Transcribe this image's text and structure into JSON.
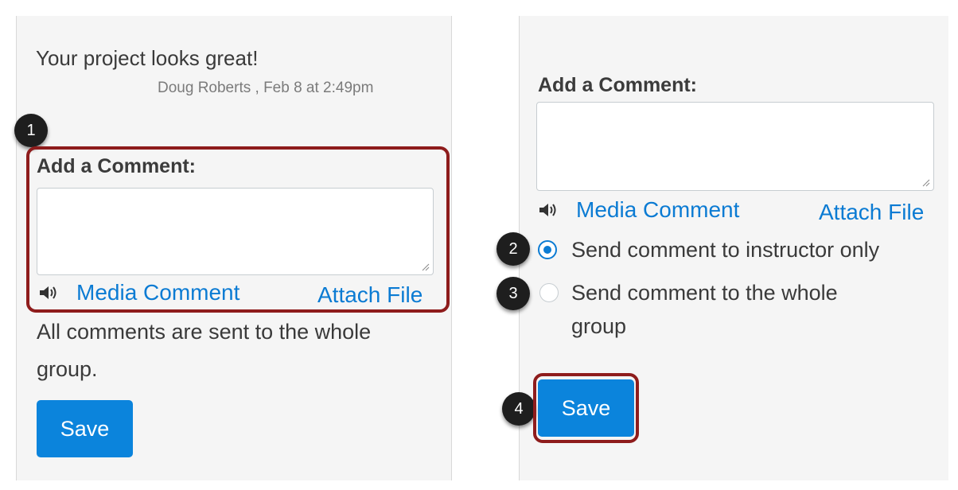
{
  "left": {
    "comment_text": "Your project looks great!",
    "comment_meta": "Doug Roberts , Feb 8 at 2:49pm",
    "badge": "1",
    "add_comment_heading": "Add a Comment:",
    "media_comment_label": "Media Comment",
    "attach_file_label": "Attach File",
    "info_line1": "All comments are sent to the whole",
    "info_line2": "group.",
    "save_label": "Save"
  },
  "right": {
    "add_comment_heading": "Add a Comment:",
    "media_comment_label": "Media Comment",
    "attach_file_label": "Attach File",
    "badge2": "2",
    "badge3": "3",
    "badge4": "4",
    "option_instructor": "Send comment to instructor only",
    "option_group_line1": "Send comment to the whole",
    "option_group_line2": "group",
    "option_instructor_checked": true,
    "save_label": "Save"
  },
  "colors": {
    "link": "#0b7bd3",
    "button": "#0b84dc",
    "highlight": "#8e1c1c",
    "panel": "#f5f5f5"
  },
  "icons": [
    "speaker-icon",
    "resize-handle-icon",
    "radio-checked",
    "radio-unchecked"
  ]
}
